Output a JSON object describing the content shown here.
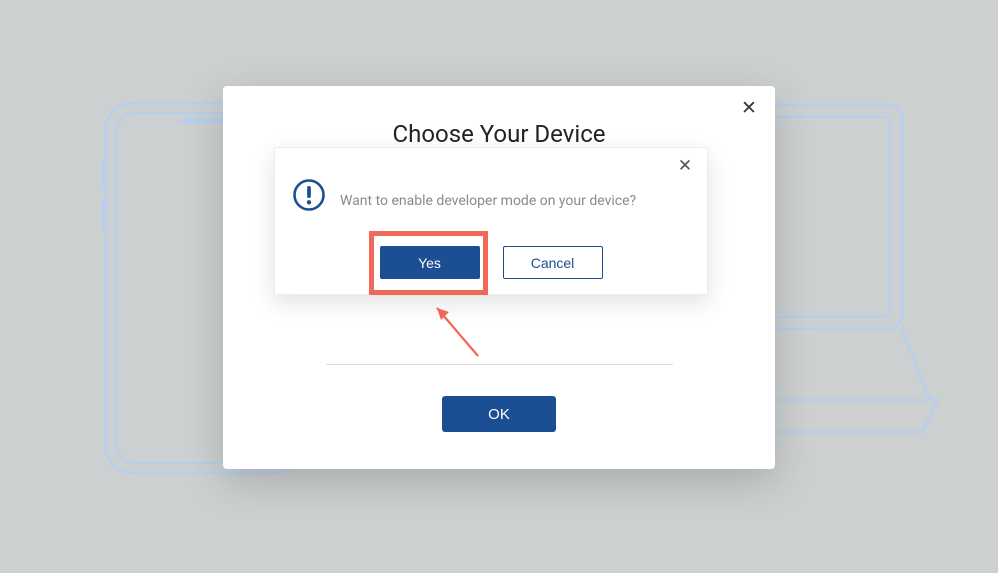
{
  "modal": {
    "title": "Choose Your Device",
    "ok_label": "OK"
  },
  "confirm": {
    "message": "Want to enable developer mode on your device?",
    "yes_label": "Yes",
    "cancel_label": "Cancel"
  },
  "icons": {
    "close": "✕"
  },
  "highlight": {
    "target": "yes-button"
  },
  "colors": {
    "primary": "#1b4e92",
    "highlight": "#f16758",
    "ink": "#232323",
    "muted": "#8a8a8a",
    "outline": "#b6cfef",
    "bg": "#cdd0d1"
  }
}
